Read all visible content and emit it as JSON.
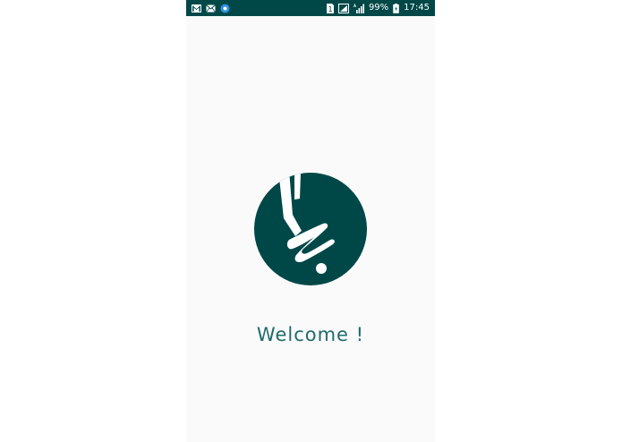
{
  "status_bar": {
    "left_icons": [
      "gmail-icon",
      "email-icon",
      "app-notification-icon"
    ],
    "sim_label": "1",
    "battery_text": "99%",
    "clock": "17:45"
  },
  "splash": {
    "logo": "app-logo",
    "welcome_text": "Welcome !"
  },
  "colors": {
    "brand": "#004848",
    "text_accent": "#1f6b6b",
    "background": "#fafafa"
  }
}
